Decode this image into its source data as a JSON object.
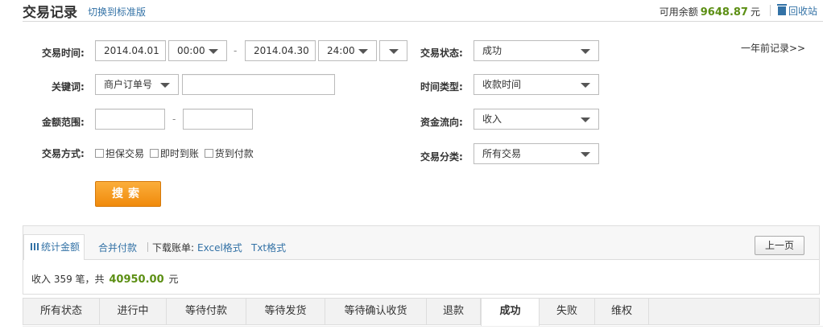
{
  "header": {
    "title": "交易记录",
    "switch_link": "切换到标准版",
    "balance_label": "可用余额",
    "balance_amount": "9648.87",
    "balance_unit": "元",
    "recycle_label": "回收站"
  },
  "form": {
    "trade_time_label": "交易时间:",
    "start_date": "2014.04.01",
    "start_time": "00:00",
    "end_date": "2014.04.30",
    "end_time": "24:00",
    "keyword_label": "关键词:",
    "keyword_type": "商户订单号",
    "keyword_value": "",
    "amount_label": "金额范围:",
    "amount_min": "",
    "amount_max": "",
    "range_dash": "-",
    "trade_mode_label": "交易方式:",
    "trade_modes": [
      "担保交易",
      "即时到账",
      "货到付款"
    ],
    "trade_status_label": "交易状态:",
    "trade_status": "成功",
    "time_type_label": "时间类型:",
    "time_type": "收款时间",
    "fund_flow_label": "资金流向:",
    "fund_flow": "收入",
    "trade_category_label": "交易分类:",
    "trade_category": "所有交易",
    "search_button": "搜索",
    "year_ago_link": "一年前记录>>"
  },
  "summary": {
    "tab_stat": "统计金额",
    "merge_pay": "合并付款",
    "download_label": "下载账单:",
    "excel_link": "Excel格式",
    "txt_link": "Txt格式",
    "prev_page": "上一页",
    "income_prefix": "收入 359 笔，共",
    "income_amount": "40950.00",
    "income_unit": "元"
  },
  "status_tabs": [
    "所有状态",
    "进行中",
    "等待付款",
    "等待发货",
    "等待确认收货",
    "退款",
    "成功",
    "失败",
    "维权"
  ],
  "active_status": "成功"
}
